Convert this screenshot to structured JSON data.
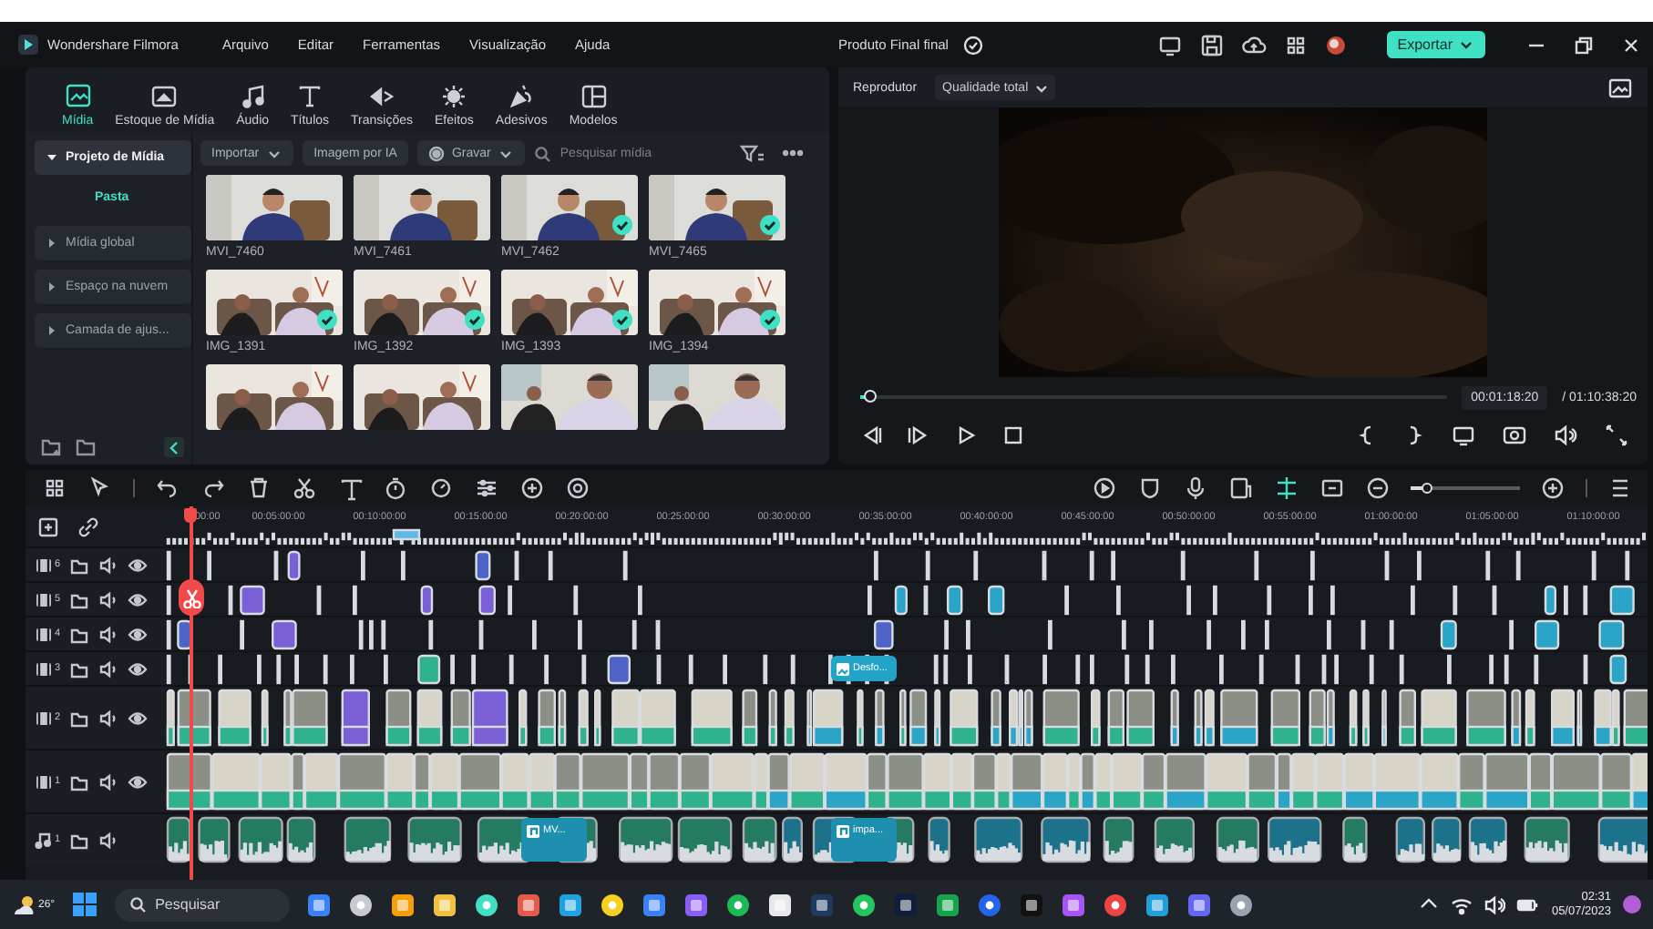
{
  "title_bar": {
    "app_name": "Wondershare Filmora",
    "menu": [
      "Arquivo",
      "Editar",
      "Ferramentas",
      "Visualização",
      "Ajuda"
    ],
    "project_name": "Produto Final final",
    "export_button": "Exportar"
  },
  "toolbar_tabs": [
    {
      "label": "Mídia",
      "selected": true
    },
    {
      "label": "Estoque de Mídia",
      "selected": false
    },
    {
      "label": "Áudio",
      "selected": false
    },
    {
      "label": "Títulos",
      "selected": false
    },
    {
      "label": "Transições",
      "selected": false
    },
    {
      "label": "Efeitos",
      "selected": false
    },
    {
      "label": "Adesivos",
      "selected": false
    },
    {
      "label": "Modelos",
      "selected": false
    }
  ],
  "sidebar": {
    "items": [
      {
        "label": "Projeto de Mídia",
        "expanded": true,
        "selected": true,
        "children": [
          {
            "label": "Pasta",
            "selected": true
          }
        ]
      },
      {
        "label": "Mídia global",
        "expanded": false,
        "selected": false
      },
      {
        "label": "Espaço na nuvem",
        "expanded": false,
        "selected": false
      },
      {
        "label": "Camada de ajus...",
        "expanded": false,
        "selected": false
      }
    ]
  },
  "media": {
    "buttons": [
      {
        "label": "Importar",
        "kind": "dropdown"
      },
      {
        "label": "Imagem por IA",
        "kind": "plain"
      },
      {
        "label": "Gravar",
        "kind": "record"
      }
    ],
    "search": {
      "placeholder": "Pesquisar mídia"
    },
    "items": [
      {
        "name": "MVI_7460",
        "used": false
      },
      {
        "name": "MVI_7461",
        "used": false
      },
      {
        "name": "MVI_7462",
        "used": true
      },
      {
        "name": "MVI_7465",
        "used": true
      },
      {
        "name": "IMG_1391",
        "used": true
      },
      {
        "name": "IMG_1392",
        "used": true
      },
      {
        "name": "IMG_1393",
        "used": true
      },
      {
        "name": "IMG_1394",
        "used": true
      },
      {
        "used": false
      },
      {
        "used": false
      },
      {
        "used": false
      },
      {
        "used": false
      }
    ]
  },
  "player": {
    "label": "Reprodutor",
    "quality": "Qualidade total",
    "level": 0.02,
    "current_time": "00:01:18:20",
    "total_time": "/ 01:10:38:20"
  },
  "timeline": {
    "zoom": {
      "level": 0.15
    },
    "ruler": [
      "00:00",
      "00:05:00:00",
      "00:10:00:00",
      "00:15:00:00",
      "00:20:00:00",
      "00:25:00:00",
      "00:30:00:00",
      "00:35:00:00",
      "00:40:00:00",
      "00:45:00:00",
      "00:50:00:00",
      "00:55:00:00",
      "01:00:00:00",
      "01:05:00:00",
      "01:10:00:00"
    ],
    "tracks": [
      {
        "kind": "effects",
        "number": "6"
      },
      {
        "kind": "effects",
        "number": "5"
      },
      {
        "kind": "effects",
        "number": "4"
      },
      {
        "kind": "effects",
        "number": "3",
        "clips": [
          {
            "label": "Desfo...",
            "kind": "effect"
          }
        ]
      },
      {
        "kind": "video",
        "number": "2"
      },
      {
        "kind": "video",
        "number": "1"
      },
      {
        "kind": "audio",
        "number": "1",
        "clips": [
          {
            "label": "MV...",
            "kind": "music"
          },
          {
            "label": "impa...",
            "kind": "music"
          }
        ]
      }
    ]
  },
  "taskbar": {
    "temperature": "26°",
    "search_placeholder": "Pesquisar",
    "time": "02:31",
    "date": "05/07/2023"
  }
}
